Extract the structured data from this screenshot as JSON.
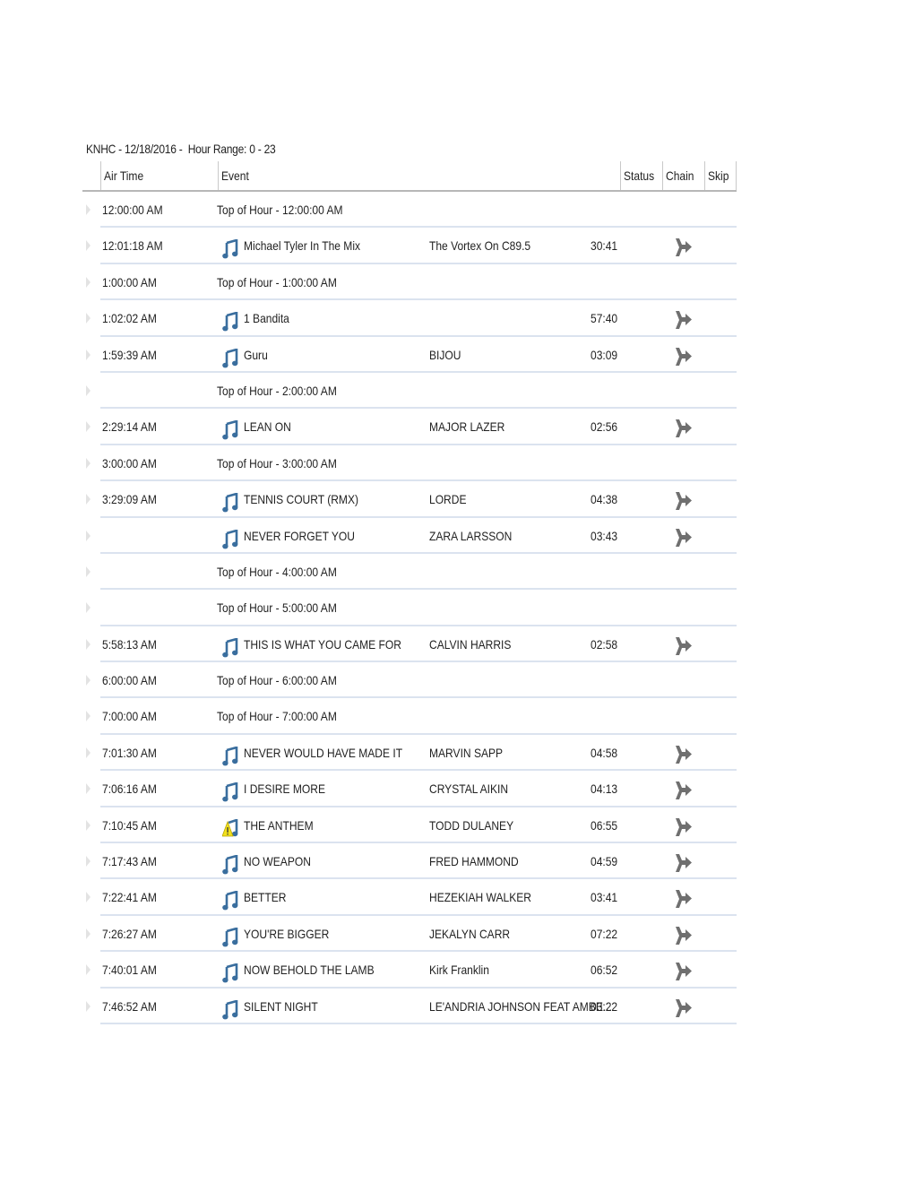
{
  "header": {
    "title": "KNHC - 12/18/2016 -  Hour Range: 0 - 23"
  },
  "columns": {
    "air_time": "Air Time",
    "event": "Event",
    "status": "Status",
    "chain": "Chain",
    "skip": "Skip"
  },
  "colors": {
    "note_icon": "#3a6e9e",
    "chain_icon": "#6f6f6f",
    "row_divider": "#dbe3ef",
    "warning": "#f2e11c"
  },
  "rows": [
    {
      "type": "top",
      "air_time": "12:00:00 AM",
      "event": "Top of Hour - 12:00:00 AM"
    },
    {
      "type": "song",
      "air_time": "12:01:18 AM",
      "icon": "music-note-icon",
      "title": "Michael Tyler In The Mix",
      "artist": "The Vortex On C89.5",
      "duration": "30:41",
      "chain": "chain-icon"
    },
    {
      "type": "top",
      "air_time": "1:00:00 AM",
      "event": "Top of Hour - 1:00:00 AM"
    },
    {
      "type": "song",
      "air_time": "1:02:02 AM",
      "icon": "music-note-icon",
      "title": "1 Bandita",
      "artist": "",
      "duration": "57:40",
      "chain": "chain-icon"
    },
    {
      "type": "song",
      "air_time": "1:59:39 AM",
      "icon": "music-note-icon",
      "title": "Guru",
      "artist": "BIJOU",
      "duration": "03:09",
      "chain": "chain-icon"
    },
    {
      "type": "top",
      "air_time": "",
      "event": "Top of Hour - 2:00:00 AM"
    },
    {
      "type": "song",
      "air_time": "2:29:14 AM",
      "icon": "music-note-icon",
      "title": "LEAN ON",
      "artist": "MAJOR LAZER",
      "duration": "02:56",
      "chain": "chain-icon"
    },
    {
      "type": "top",
      "air_time": "3:00:00 AM",
      "event": "Top of Hour - 3:00:00 AM"
    },
    {
      "type": "song",
      "air_time": "3:29:09 AM",
      "icon": "music-note-icon",
      "title": "TENNIS COURT (RMX)",
      "artist": "LORDE",
      "duration": "04:38",
      "chain": "chain-icon"
    },
    {
      "type": "song",
      "air_time": "",
      "icon": "music-note-icon",
      "title": "NEVER FORGET YOU",
      "artist": "ZARA LARSSON",
      "duration": "03:43",
      "chain": "chain-icon"
    },
    {
      "type": "top",
      "air_time": "",
      "event": "Top of Hour - 4:00:00 AM"
    },
    {
      "type": "top",
      "air_time": "",
      "event": "Top of Hour - 5:00:00 AM"
    },
    {
      "type": "song",
      "air_time": "5:58:13 AM",
      "icon": "music-note-icon",
      "title": "THIS IS WHAT YOU CAME FOR",
      "artist": "CALVIN HARRIS",
      "duration": "02:58",
      "chain": "chain-icon"
    },
    {
      "type": "top",
      "air_time": "6:00:00 AM",
      "event": "Top of Hour - 6:00:00 AM"
    },
    {
      "type": "top",
      "air_time": "7:00:00 AM",
      "event": "Top of Hour - 7:00:00 AM"
    },
    {
      "type": "song",
      "air_time": "7:01:30 AM",
      "icon": "music-note-icon",
      "title": "NEVER WOULD HAVE MADE IT",
      "artist": "MARVIN SAPP",
      "duration": "04:58",
      "chain": "chain-icon"
    },
    {
      "type": "song",
      "air_time": "7:06:16 AM",
      "icon": "music-note-icon",
      "title": "I DESIRE MORE",
      "artist": "CRYSTAL AIKIN",
      "duration": "04:13",
      "chain": "chain-icon"
    },
    {
      "type": "song",
      "air_time": "7:10:45 AM",
      "icon": "music-note-warning-icon",
      "title": "THE ANTHEM",
      "artist": "TODD DULANEY",
      "duration": "06:55",
      "chain": "chain-icon"
    },
    {
      "type": "song",
      "air_time": "7:17:43 AM",
      "icon": "music-note-icon",
      "title": "NO WEAPON",
      "artist": "FRED HAMMOND",
      "duration": "04:59",
      "chain": "chain-icon"
    },
    {
      "type": "song",
      "air_time": "7:22:41 AM",
      "icon": "music-note-icon",
      "title": "BETTER",
      "artist": "HEZEKIAH WALKER",
      "duration": "03:41",
      "chain": "chain-icon"
    },
    {
      "type": "song",
      "air_time": "7:26:27 AM",
      "icon": "music-note-icon",
      "title": "YOU'RE BIGGER",
      "artist": "JEKALYN CARR",
      "duration": "07:22",
      "chain": "chain-icon"
    },
    {
      "type": "song",
      "air_time": "7:40:01 AM",
      "icon": "music-note-icon",
      "title": "NOW BEHOLD THE LAMB",
      "artist": "Kirk Franklin",
      "duration": "06:52",
      "chain": "chain-icon"
    },
    {
      "type": "song",
      "air_time": "7:46:52 AM",
      "icon": "music-note-icon",
      "title": "SILENT NIGHT",
      "artist": "LE'ANDRIA JOHNSON FEAT AMBE...",
      "duration": "03:22",
      "chain": "chain-icon"
    }
  ]
}
